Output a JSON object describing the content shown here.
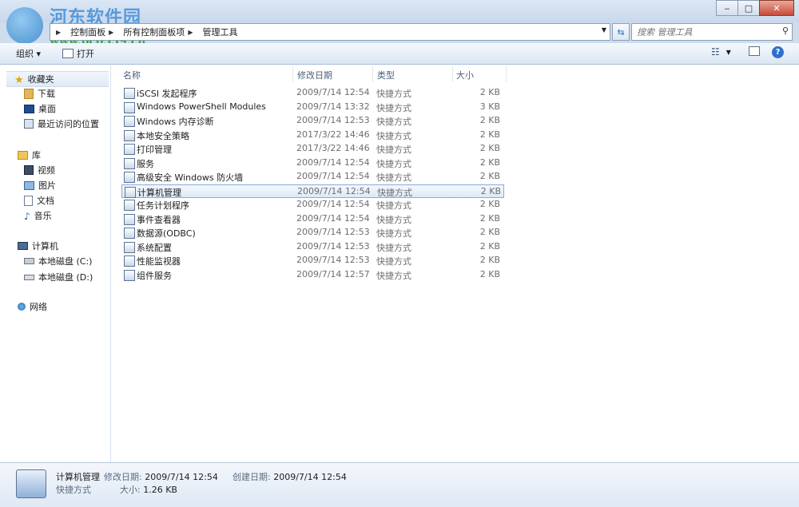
{
  "watermark": {
    "title": "河东软件园",
    "url": "www.pc0359.cn"
  },
  "window_buttons": {
    "minimize": "‒",
    "maximize": "□",
    "close": "✕"
  },
  "address": {
    "crumbs": [
      "控制面板",
      "所有控制面板项",
      "管理工具"
    ]
  },
  "search": {
    "placeholder": "搜索 管理工具"
  },
  "toolbar": {
    "organize": "组织 ▾",
    "open": "打开"
  },
  "sidebar": {
    "favorites": {
      "label": "收藏夹",
      "items": [
        "下载",
        "桌面",
        "最近访问的位置"
      ]
    },
    "libraries": {
      "label": "库",
      "items": [
        "视频",
        "图片",
        "文档",
        "音乐"
      ]
    },
    "computer": {
      "label": "计算机",
      "items": [
        "本地磁盘 (C:)",
        "本地磁盘 (D:)"
      ]
    },
    "network": {
      "label": "网络"
    }
  },
  "columns": {
    "name": "名称",
    "date": "修改日期",
    "type": "类型",
    "size": "大小"
  },
  "files": [
    {
      "name": "iSCSI 发起程序",
      "date": "2009/7/14 12:54",
      "type": "快捷方式",
      "size": "2 KB"
    },
    {
      "name": "Windows PowerShell Modules",
      "date": "2009/7/14 13:32",
      "type": "快捷方式",
      "size": "3 KB"
    },
    {
      "name": "Windows 内存诊断",
      "date": "2009/7/14 12:53",
      "type": "快捷方式",
      "size": "2 KB"
    },
    {
      "name": "本地安全策略",
      "date": "2017/3/22 14:46",
      "type": "快捷方式",
      "size": "2 KB"
    },
    {
      "name": "打印管理",
      "date": "2017/3/22 14:46",
      "type": "快捷方式",
      "size": "2 KB"
    },
    {
      "name": "服务",
      "date": "2009/7/14 12:54",
      "type": "快捷方式",
      "size": "2 KB"
    },
    {
      "name": "高级安全 Windows 防火墙",
      "date": "2009/7/14 12:54",
      "type": "快捷方式",
      "size": "2 KB"
    },
    {
      "name": "计算机管理",
      "date": "2009/7/14 12:54",
      "type": "快捷方式",
      "size": "2 KB"
    },
    {
      "name": "任务计划程序",
      "date": "2009/7/14 12:54",
      "type": "快捷方式",
      "size": "2 KB"
    },
    {
      "name": "事件查看器",
      "date": "2009/7/14 12:54",
      "type": "快捷方式",
      "size": "2 KB"
    },
    {
      "name": "数据源(ODBC)",
      "date": "2009/7/14 12:53",
      "type": "快捷方式",
      "size": "2 KB"
    },
    {
      "name": "系统配置",
      "date": "2009/7/14 12:53",
      "type": "快捷方式",
      "size": "2 KB"
    },
    {
      "name": "性能监视器",
      "date": "2009/7/14 12:53",
      "type": "快捷方式",
      "size": "2 KB"
    },
    {
      "name": "组件服务",
      "date": "2009/7/14 12:57",
      "type": "快捷方式",
      "size": "2 KB"
    }
  ],
  "details": {
    "name": "计算机管理",
    "type": "快捷方式",
    "modified_label": "修改日期:",
    "modified": "2009/7/14 12:54",
    "created_label": "创建日期:",
    "created": "2009/7/14 12:54",
    "size_label": "大小:",
    "size": "1.26 KB"
  }
}
